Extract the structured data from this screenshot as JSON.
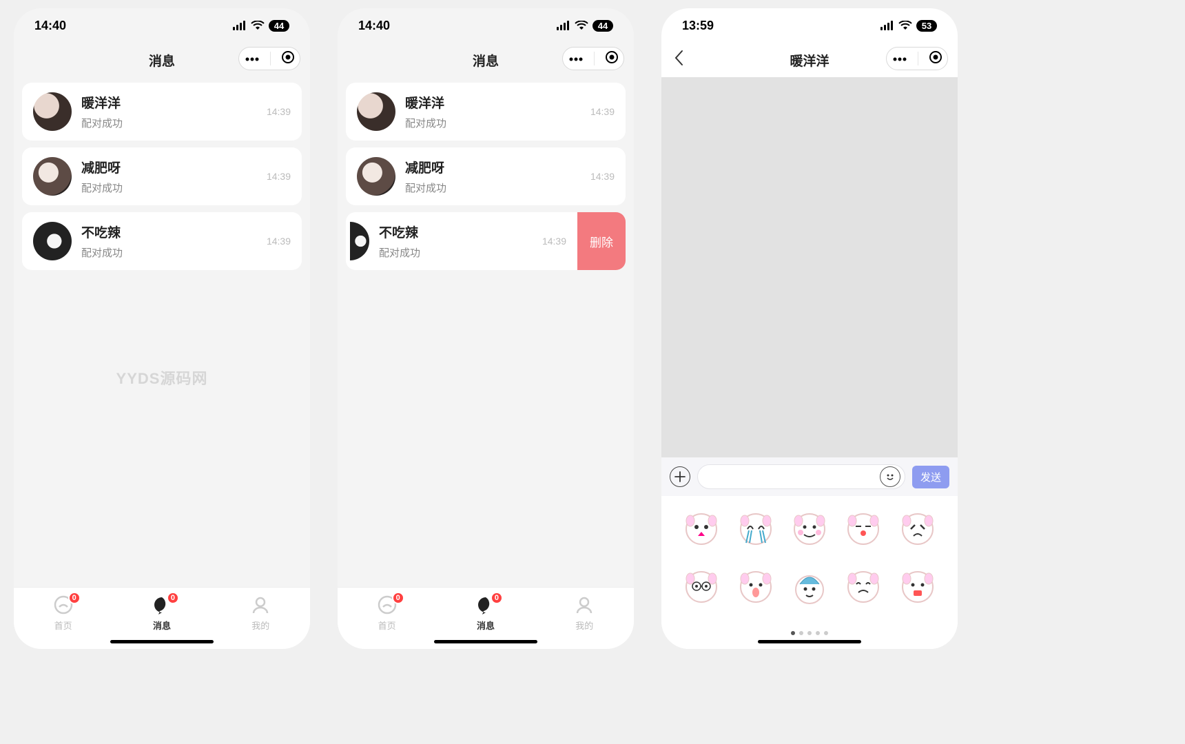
{
  "screens": [
    {
      "status": {
        "time": "14:40",
        "battery": "44"
      },
      "title": "消息",
      "watermark": "YYDS源码网",
      "conversations": [
        {
          "name": "暖洋洋",
          "sub": "配对成功",
          "time": "14:39"
        },
        {
          "name": "减肥呀",
          "sub": "配对成功",
          "time": "14:39"
        },
        {
          "name": "不吃辣",
          "sub": "配对成功",
          "time": "14:39"
        }
      ],
      "tabs": [
        {
          "label": "首页",
          "badge": "0",
          "active": false
        },
        {
          "label": "消息",
          "badge": "0",
          "active": true
        },
        {
          "label": "我的",
          "active": false
        }
      ]
    },
    {
      "status": {
        "time": "14:40",
        "battery": "44"
      },
      "title": "消息",
      "conversations": [
        {
          "name": "暖洋洋",
          "sub": "配对成功",
          "time": "14:39"
        },
        {
          "name": "减肥呀",
          "sub": "配对成功",
          "time": "14:39"
        },
        {
          "name": "不吃辣",
          "sub": "配对成功",
          "time": "14:39",
          "swiped": true,
          "delete_label": "删除"
        }
      ],
      "tabs": [
        {
          "label": "首页",
          "badge": "0",
          "active": false
        },
        {
          "label": "消息",
          "badge": "0",
          "active": true
        },
        {
          "label": "我的",
          "active": false
        }
      ]
    },
    {
      "status": {
        "time": "13:59",
        "battery": "53"
      },
      "title": "暖洋洋",
      "send_label": "发送",
      "sticker_count": 10
    }
  ]
}
